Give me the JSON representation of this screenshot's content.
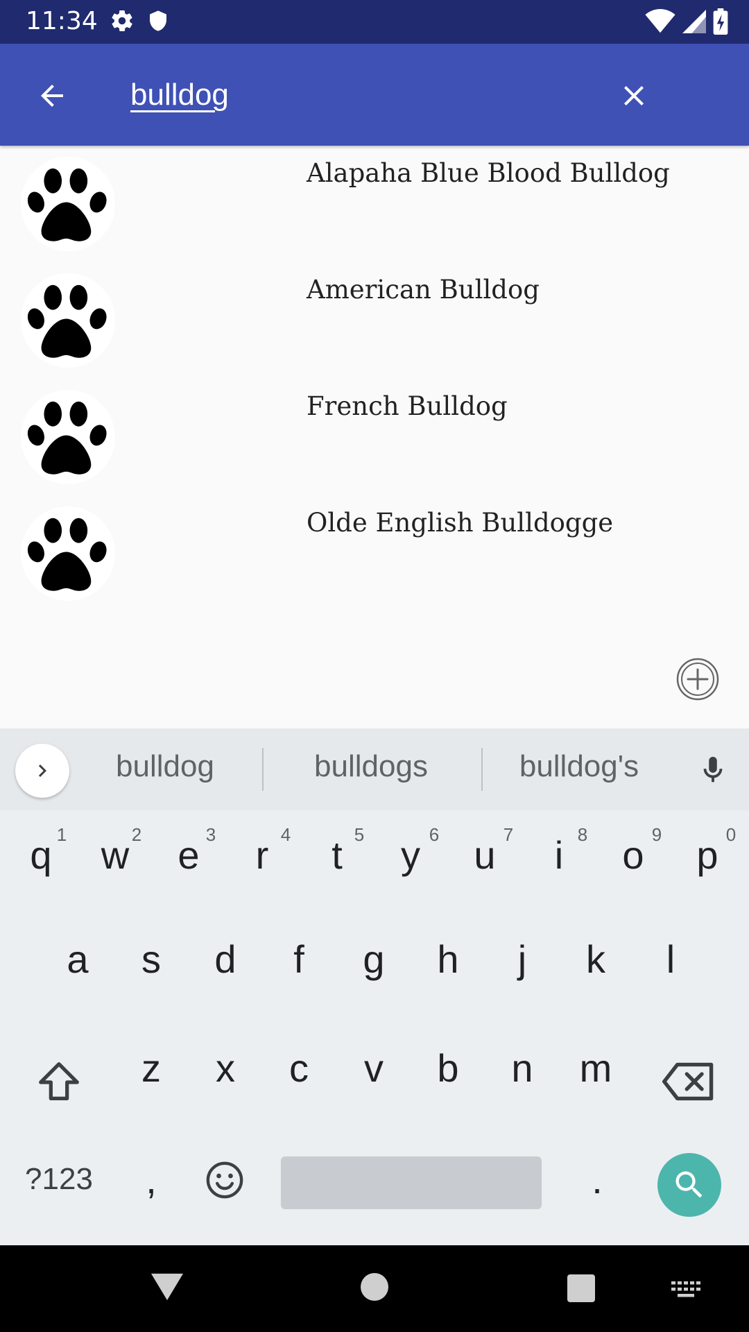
{
  "status_bar": {
    "time": "11:34"
  },
  "app_bar": {
    "search_value": "bulldog",
    "colors": {
      "primary": "#3f51b5",
      "status": "#202a6e"
    }
  },
  "results": [
    {
      "name": "Alapaha Blue Blood Bulldog",
      "icon": "paw-icon"
    },
    {
      "name": "American Bulldog",
      "icon": "paw-icon"
    },
    {
      "name": "French Bulldog",
      "icon": "paw-icon"
    },
    {
      "name": "Olde English Bulldogge",
      "icon": "paw-icon"
    }
  ],
  "keyboard": {
    "suggestions": [
      "bulldog",
      "bulldogs",
      "bulldog's"
    ],
    "row1": [
      "q",
      "w",
      "e",
      "r",
      "t",
      "y",
      "u",
      "i",
      "o",
      "p"
    ],
    "row1_hints": [
      "1",
      "2",
      "3",
      "4",
      "5",
      "6",
      "7",
      "8",
      "9",
      "0"
    ],
    "row2": [
      "a",
      "s",
      "d",
      "f",
      "g",
      "h",
      "j",
      "k",
      "l"
    ],
    "row3": [
      "z",
      "x",
      "c",
      "v",
      "b",
      "n",
      "m"
    ],
    "symbols_label": "?123",
    "comma": ",",
    "period": ".",
    "search_key_color": "#4db6ac"
  }
}
